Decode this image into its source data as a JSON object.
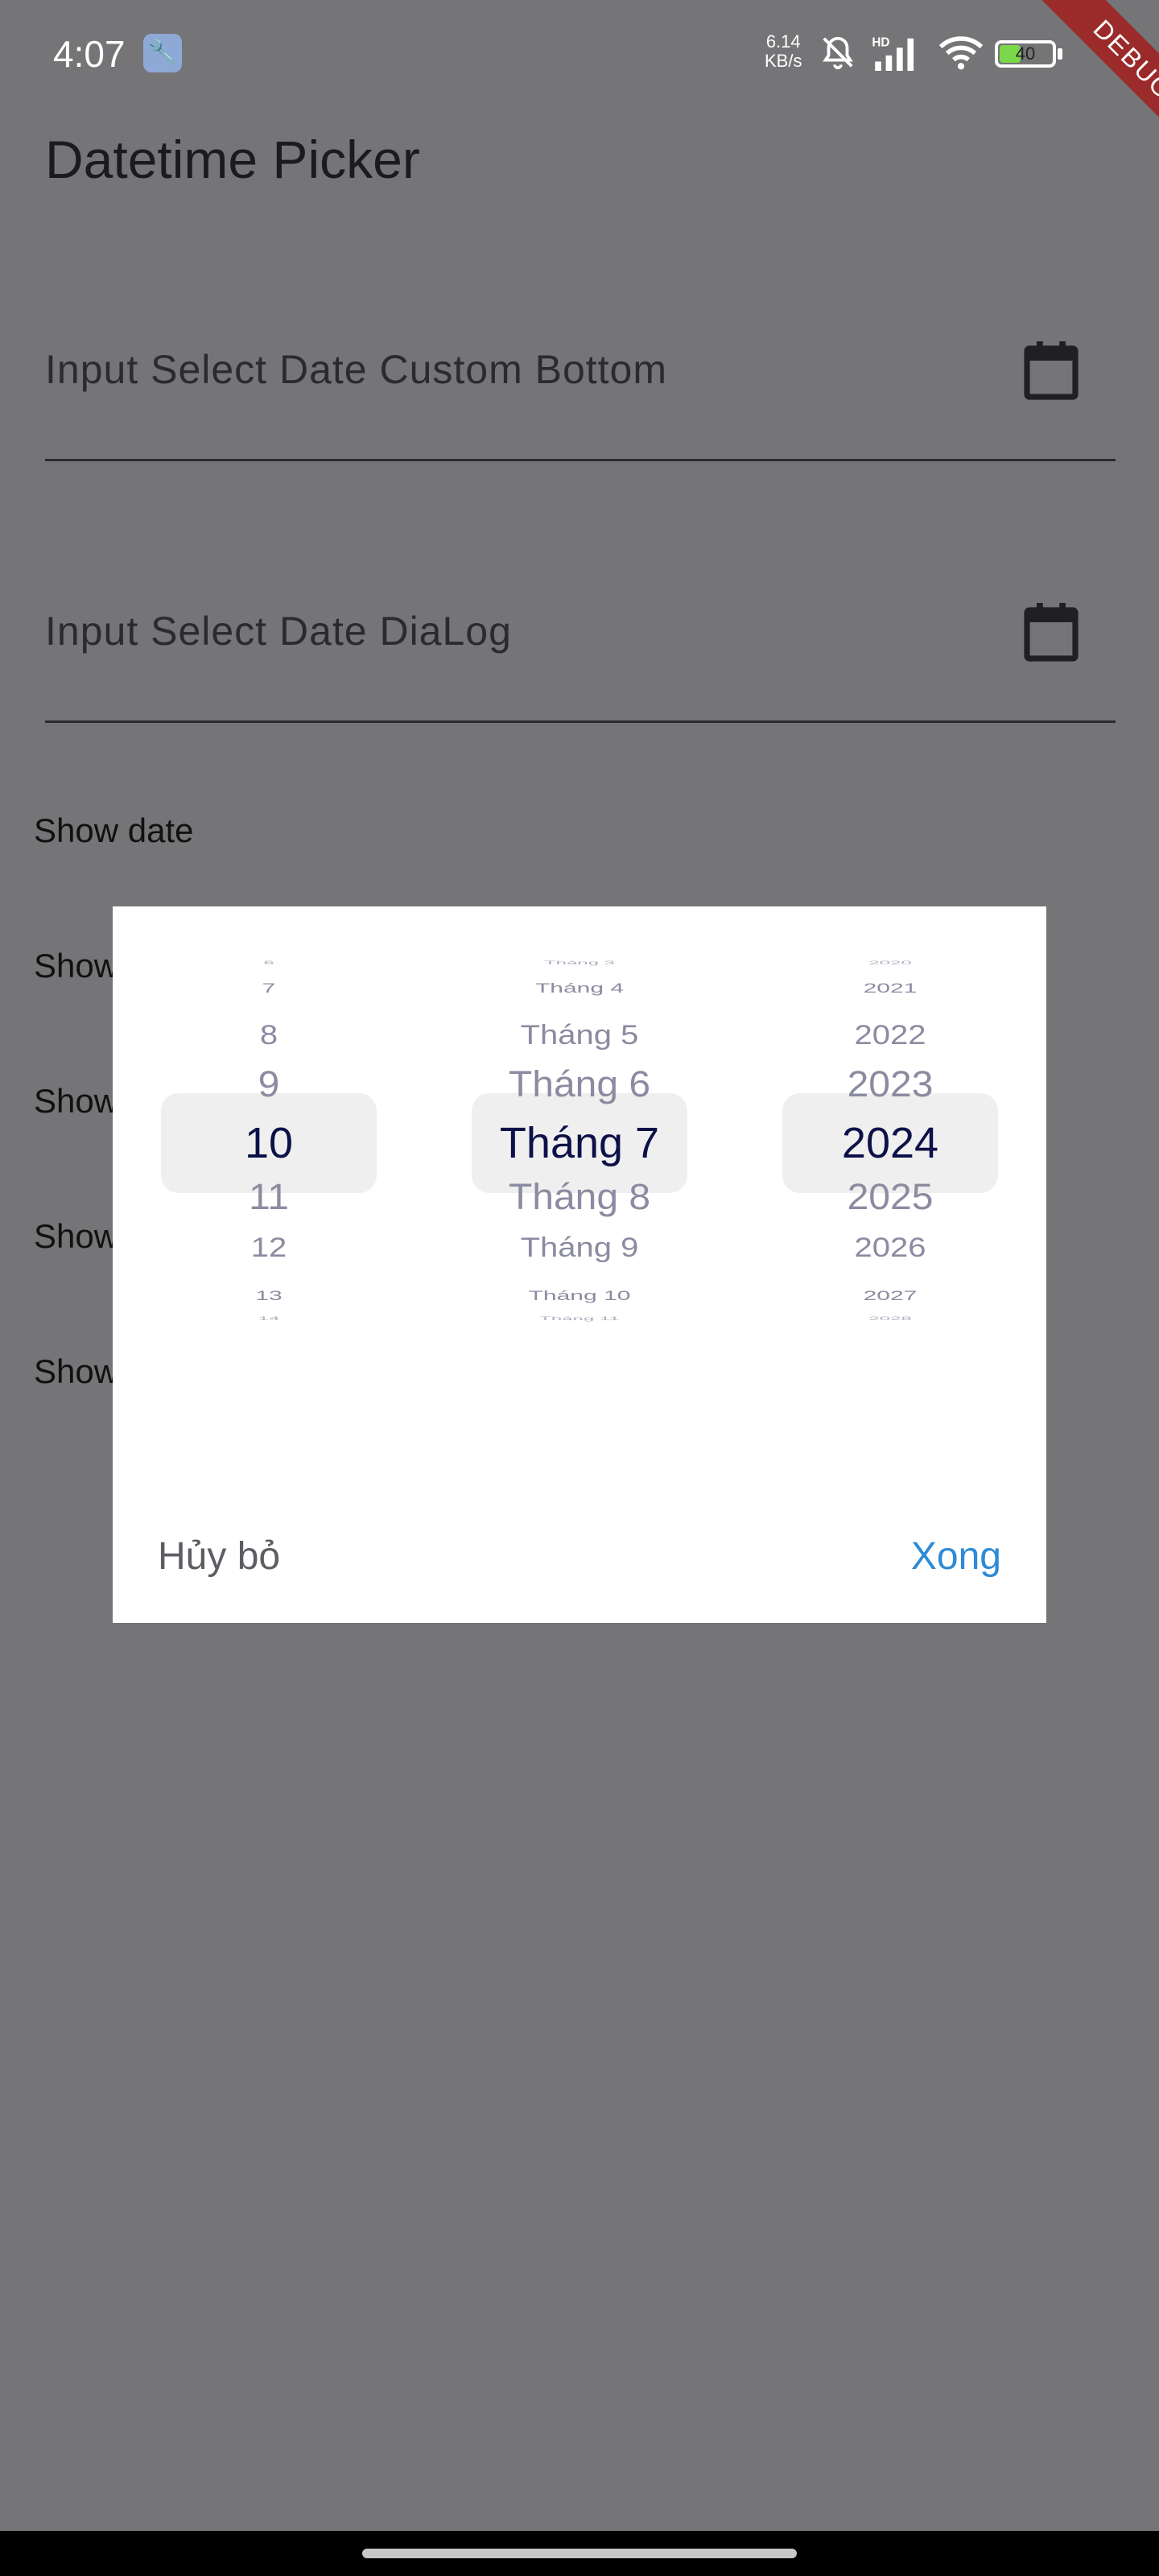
{
  "status_bar": {
    "time": "4:07",
    "net_speed_value": "6.14",
    "net_speed_unit": "KB/s",
    "network_label": "HD",
    "battery_level": "40",
    "battery_fraction": 0.4,
    "debug_banner": "DEBUG"
  },
  "app_bar": {
    "title": "Datetime Picker"
  },
  "fields": [
    {
      "label": "Input Select Date Custom Bottom",
      "icon": "calendar-icon"
    },
    {
      "label": "Input Select Date DiaLog",
      "icon": "calendar-icon"
    }
  ],
  "show_items": [
    "Show date",
    "Show",
    "Show",
    "Show",
    "Show"
  ],
  "dialog": {
    "day_column": [
      {
        "text": "6",
        "sel": false
      },
      {
        "text": "7",
        "sel": false
      },
      {
        "text": "8",
        "sel": false
      },
      {
        "text": "9",
        "sel": false
      },
      {
        "text": "10",
        "sel": true
      },
      {
        "text": "11",
        "sel": false
      },
      {
        "text": "12",
        "sel": false
      },
      {
        "text": "13",
        "sel": false
      },
      {
        "text": "14",
        "sel": false
      }
    ],
    "month_column": [
      {
        "text": "Tháng 3",
        "sel": false
      },
      {
        "text": "Tháng 4",
        "sel": false
      },
      {
        "text": "Tháng 5",
        "sel": false
      },
      {
        "text": "Tháng 6",
        "sel": false
      },
      {
        "text": "Tháng 7",
        "sel": true
      },
      {
        "text": "Tháng 8",
        "sel": false
      },
      {
        "text": "Tháng 9",
        "sel": false
      },
      {
        "text": "Tháng 10",
        "sel": false
      },
      {
        "text": "Tháng 11",
        "sel": false
      }
    ],
    "year_column": [
      {
        "text": "2020",
        "sel": false
      },
      {
        "text": "2021",
        "sel": false
      },
      {
        "text": "2022",
        "sel": false
      },
      {
        "text": "2023",
        "sel": false
      },
      {
        "text": "2024",
        "sel": true
      },
      {
        "text": "2025",
        "sel": false
      },
      {
        "text": "2026",
        "sel": false
      },
      {
        "text": "2027",
        "sel": false
      },
      {
        "text": "2028",
        "sel": false
      }
    ],
    "cancel_label": "Hủy bỏ",
    "done_label": "Xong"
  },
  "colors": {
    "scrim": "#757477",
    "accent": "#2d8ad6",
    "selected_text": "#0d1148",
    "unselected_text": "#8b8ba1",
    "debug_banner": "#9b2b2b"
  }
}
